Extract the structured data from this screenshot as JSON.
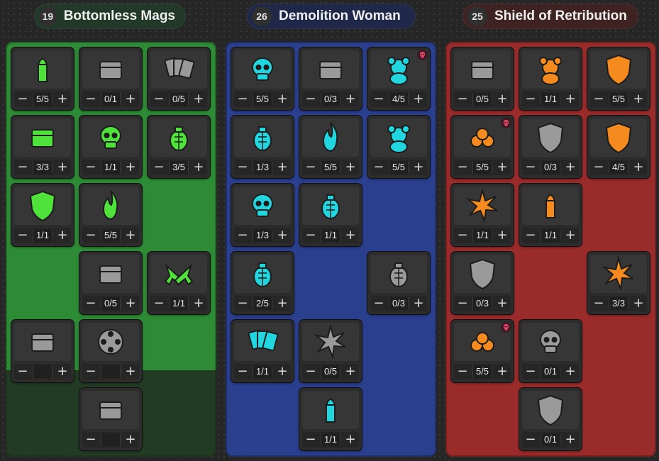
{
  "colors": {
    "green_panel": "#2d8a35",
    "blue_panel": "#2a3f8e",
    "red_panel": "#9a2b2b",
    "green_icon": "#4ee23a",
    "blue_icon": "#22d6e0",
    "orange_icon": "#f58a1f",
    "gray_icon": "#9a9a9a",
    "capstone_badge": "#e2476a"
  },
  "trees": [
    {
      "id": "green",
      "points": "19",
      "name": "Bottomless Mags",
      "skills": [
        {
          "icon": "flaming-bullet-icon",
          "rank": "5/5",
          "color": "green_icon"
        },
        {
          "icon": "mounted-turret-icon",
          "rank": "0/1",
          "color": "gray_icon"
        },
        {
          "icon": "playing-cards-icon",
          "rank": "0/5",
          "color": "gray_icon"
        },
        {
          "icon": "skull-battery-icon",
          "rank": "3/3",
          "color": "green_icon"
        },
        {
          "icon": "skull-wreath-icon",
          "rank": "1/1",
          "color": "green_icon"
        },
        {
          "icon": "grenade-bundle-icon",
          "rank": "3/5",
          "color": "green_icon"
        },
        {
          "icon": "laurel-shield-icon",
          "rank": "1/1",
          "color": "green_icon"
        },
        {
          "icon": "flaming-helmet-icon",
          "rank": "5/5",
          "color": "green_icon"
        },
        {
          "icon": "ammo-crate-icon",
          "rank": "0/5",
          "color": "gray_icon"
        },
        {
          "icon": "crossed-revolvers-icon",
          "rank": "1/1",
          "color": "green_icon"
        },
        {
          "icon": "infinite-magazine-icon",
          "rank": "",
          "color": "gray_icon"
        },
        {
          "icon": "revolver-cylinder-icon",
          "rank": "",
          "color": "gray_icon"
        },
        {
          "icon": "stacked-crates-icon",
          "rank": "",
          "color": "gray_icon"
        }
      ]
    },
    {
      "id": "blue",
      "points": "26",
      "name": "Demolition Woman",
      "skills": [
        {
          "icon": "flaming-skull-icon",
          "rank": "5/5",
          "color": "blue_icon"
        },
        {
          "icon": "explosive-dispenser-icon",
          "rank": "0/3",
          "color": "gray_icon"
        },
        {
          "icon": "roaring-beast-icon",
          "rank": "4/5",
          "color": "blue_icon",
          "capstone": true
        },
        {
          "icon": "grenade-fish-icon",
          "rank": "1/3",
          "color": "blue_icon"
        },
        {
          "icon": "mushroom-cloud-icon",
          "rank": "5/5",
          "color": "blue_icon"
        },
        {
          "icon": "teddy-bear-icon",
          "rank": "5/5",
          "color": "blue_icon"
        },
        {
          "icon": "skull-grenade-icon",
          "rank": "1/3",
          "color": "blue_icon"
        },
        {
          "icon": "grenade-robot-icon",
          "rank": "1/1",
          "color": "blue_icon"
        },
        {
          "icon": "grenade-burst-icon",
          "rank": "2/5",
          "color": "blue_icon"
        },
        {
          "icon": "grenade-stack-icon",
          "rank": "0/3",
          "color": "gray_icon"
        },
        {
          "icon": "grenade-card-icon",
          "rank": "1/1",
          "color": "blue_icon"
        },
        {
          "icon": "spark-grenade-icon",
          "rank": "0/5",
          "color": "gray_icon"
        },
        {
          "icon": "sparking-bullet-icon",
          "rank": "1/1",
          "color": "blue_icon"
        }
      ]
    },
    {
      "id": "red",
      "points": "25",
      "name": "Shield of Retribution",
      "skills": [
        {
          "icon": "grenade-pouch-icon",
          "rank": "0/5",
          "color": "gray_icon"
        },
        {
          "icon": "teddy-bear-icon",
          "rank": "1/1",
          "color": "orange_icon"
        },
        {
          "icon": "diamond-shield-icon",
          "rank": "5/5",
          "color": "orange_icon"
        },
        {
          "icon": "shell-belt-icon",
          "rank": "5/5",
          "color": "orange_icon",
          "capstone": true
        },
        {
          "icon": "steel-shield-icon",
          "rank": "0/3",
          "color": "gray_icon"
        },
        {
          "icon": "alert-shield-icon",
          "rank": "4/5",
          "color": "orange_icon"
        },
        {
          "icon": "exploding-can-icon",
          "rank": "1/1",
          "color": "orange_icon"
        },
        {
          "icon": "firework-rocket-icon",
          "rank": "1/1",
          "color": "orange_icon"
        },
        {
          "icon": "star-badge-icon",
          "rank": "0/3",
          "color": "gray_icon"
        },
        {
          "icon": "pistol-blast-icon",
          "rank": "3/3",
          "color": "orange_icon"
        },
        {
          "icon": "coin-cluster-icon",
          "rank": "5/5",
          "color": "orange_icon",
          "capstone": true
        },
        {
          "icon": "skull-shield-icon",
          "rank": "0/1",
          "color": "gray_icon"
        },
        {
          "icon": "cracked-shield-icon",
          "rank": "0/1",
          "color": "gray_icon"
        }
      ]
    }
  ],
  "controls": {
    "minus": "−",
    "plus": "+"
  }
}
